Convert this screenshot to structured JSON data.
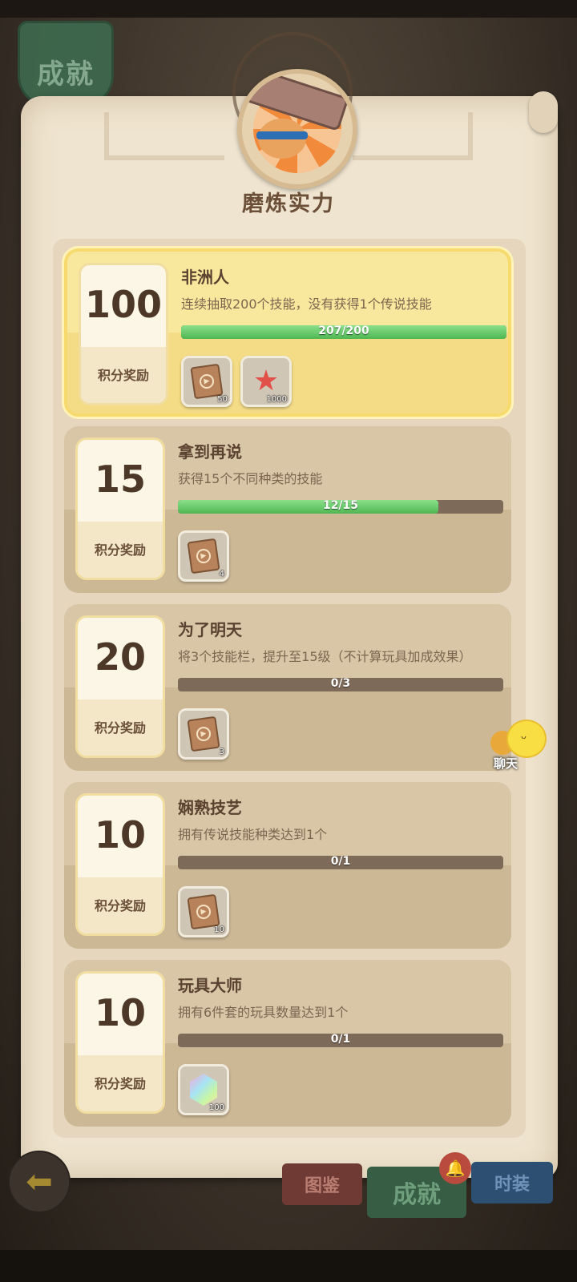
{
  "header": {
    "tab_label": "成就",
    "section_title": "磨炼实力",
    "medal_icon": "hammer-medal-icon"
  },
  "achievements": [
    {
      "name": "非洲人",
      "description": "连续抽取200个技能，没有获得1个传说技能",
      "points": "100",
      "points_label": "积分奖励",
      "progress_text": "207/200",
      "progress": 1.0,
      "highlighted": true,
      "rewards": [
        {
          "icon": "skill-scroll-icon",
          "qty": "50"
        },
        {
          "icon": "starfish-icon",
          "qty": "1000"
        }
      ]
    },
    {
      "name": "拿到再说",
      "description": "获得15个不同种类的技能",
      "points": "15",
      "points_label": "积分奖励",
      "progress_text": "12/15",
      "progress": 0.8,
      "highlighted": false,
      "rewards": [
        {
          "icon": "skill-scroll-icon",
          "qty": "4"
        }
      ]
    },
    {
      "name": "为了明天",
      "description": "将3个技能栏，提升至15级（不计算玩具加成效果）",
      "points": "20",
      "points_label": "积分奖励",
      "progress_text": "0/3",
      "progress": 0,
      "highlighted": false,
      "rewards": [
        {
          "icon": "skill-scroll-icon",
          "qty": "3"
        }
      ]
    },
    {
      "name": "娴熟技艺",
      "description": "拥有传说技能种类达到1个",
      "points": "10",
      "points_label": "积分奖励",
      "progress_text": "0/1",
      "progress": 0,
      "highlighted": false,
      "rewards": [
        {
          "icon": "skill-scroll-icon",
          "qty": "10"
        }
      ]
    },
    {
      "name": "玩具大师",
      "description": "拥有6件套的玩具数量达到1个",
      "points": "10",
      "points_label": "积分奖励",
      "progress_text": "0/1",
      "progress": 0,
      "highlighted": false,
      "rewards": [
        {
          "icon": "crystal-icon",
          "qty": "100"
        }
      ]
    }
  ],
  "chat": {
    "label": "聊天"
  },
  "bottom_nav": {
    "back_icon": "back-arrow-icon",
    "items": [
      {
        "label": "图鉴"
      },
      {
        "label": "成就"
      },
      {
        "label": "时装"
      }
    ],
    "notification_icon": "bell-icon"
  }
}
